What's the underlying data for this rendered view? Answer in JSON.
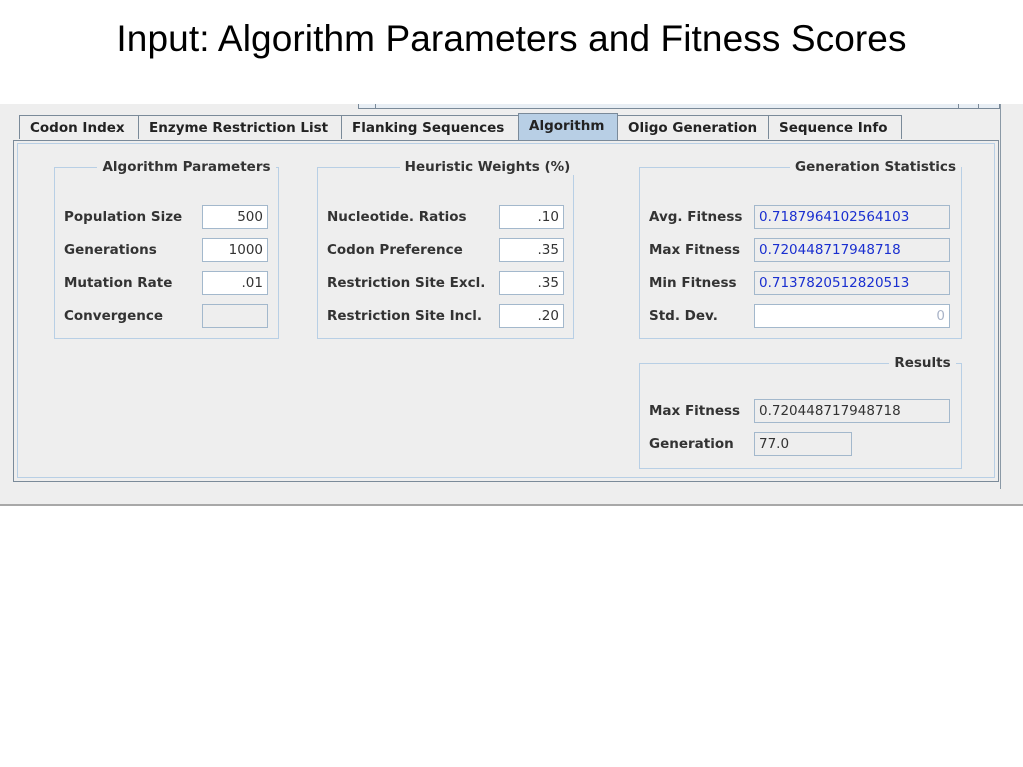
{
  "slide": {
    "title": "Input: Algorithm Parameters and Fitness Scores"
  },
  "tabs": [
    {
      "label": "Codon Index"
    },
    {
      "label": "Enzyme Restriction List"
    },
    {
      "label": "Flanking Sequences"
    },
    {
      "label": "Algorithm"
    },
    {
      "label": "Oligo Generation"
    },
    {
      "label": "Sequence Info"
    }
  ],
  "active_tab": "Algorithm",
  "algorithm_parameters": {
    "title": "Algorithm Parameters",
    "population_size": {
      "label": "Population Size",
      "value": "500"
    },
    "generations": {
      "label": "Generations",
      "value": "1000"
    },
    "mutation_rate": {
      "label": "Mutation Rate",
      "value": ".01"
    },
    "convergence": {
      "label": "Convergence",
      "value": ""
    }
  },
  "heuristic_weights": {
    "title": "Heuristic Weights (%)",
    "nucleotide_ratios": {
      "label": "Nucleotide. Ratios",
      "value": ".10"
    },
    "codon_preference": {
      "label": "Codon Preference",
      "value": ".35"
    },
    "restriction_site_excl": {
      "label": "Restriction Site Excl.",
      "value": ".35"
    },
    "restriction_site_incl": {
      "label": "Restriction Site Incl.",
      "value": ".20"
    }
  },
  "generation_statistics": {
    "title": "Generation Statistics",
    "avg_fitness": {
      "label": "Avg. Fitness",
      "value": "0.7187964102564103"
    },
    "max_fitness": {
      "label": "Max Fitness",
      "value": "0.720448717948718"
    },
    "min_fitness": {
      "label": "Min Fitness",
      "value": "0.7137820512820513"
    },
    "std_dev": {
      "label": "Std. Dev.",
      "value": "0"
    }
  },
  "results": {
    "title": "Results",
    "max_fitness": {
      "label": "Max Fitness",
      "value": "0.720448717948718"
    },
    "generation": {
      "label": "Generation",
      "value": "77.0"
    }
  },
  "colors": {
    "active_tab": "#b8cfe5",
    "stat_value_text": "#1a2fd0",
    "border": "#7a8a99"
  }
}
